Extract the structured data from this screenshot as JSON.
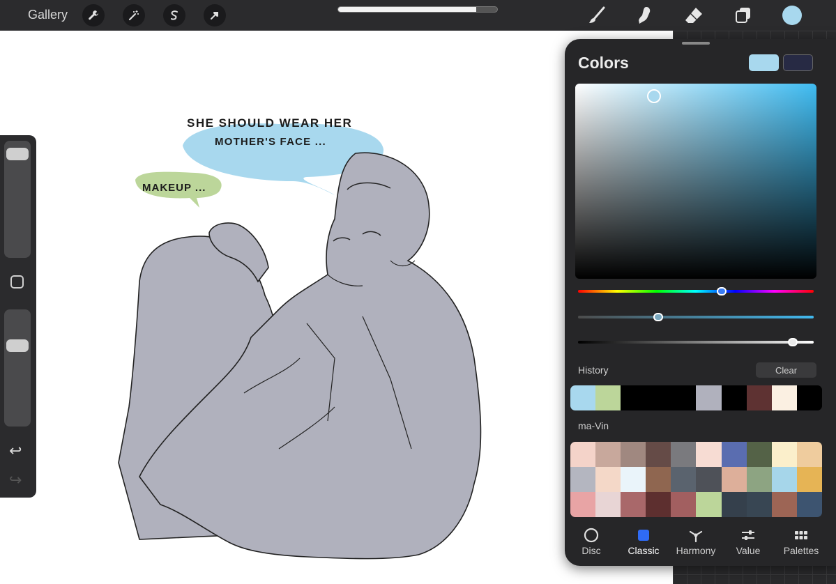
{
  "topbar": {
    "gallery_label": "Gallery",
    "left_tools": [
      {
        "icon": "wrench-icon",
        "name": "actions-button"
      },
      {
        "icon": "magic-wand-icon",
        "name": "adjustments-button"
      },
      {
        "icon": "selection-icon",
        "name": "selection-button"
      },
      {
        "icon": "arrow-cursor-icon",
        "name": "transform-button"
      }
    ],
    "progress": 0.87,
    "right_tools": [
      {
        "icon": "brush-icon",
        "name": "brush-button"
      },
      {
        "icon": "smudge-icon",
        "name": "smudge-button"
      },
      {
        "icon": "eraser-icon",
        "name": "eraser-button"
      },
      {
        "icon": "layers-icon",
        "name": "layers-button"
      }
    ],
    "current_color": "#a8d8ee"
  },
  "sidebar": {
    "brush_size_level": 0.05,
    "opacity_level": 0.28,
    "modifier_icon": "square-icon",
    "undo_icon": "undo-icon",
    "redo_icon": "redo-icon"
  },
  "colors_panel": {
    "title": "Colors",
    "primary_color": "#a8d8ee",
    "secondary_color": "#272a44",
    "hue_level": 0.61,
    "saturation_level": 0.34,
    "brightness_level": 0.91,
    "history_label": "History",
    "clear_label": "Clear",
    "history_colors": [
      "#a8d8ee",
      "#bcd69a",
      "#000000",
      "#000000",
      "#000000",
      "#b0b1bd",
      "#000000",
      "#5e3232",
      "#fbf0e2",
      "#000000"
    ],
    "palette_name": "ma-Vin",
    "palette_colors": [
      "#f4d3c9",
      "#c8a89c",
      "#a08880",
      "#654b47",
      "#7a7a7e",
      "#f7dcd3",
      "#5a6db0",
      "#546247",
      "#fbefcb",
      "#efcc9e",
      "#b4b6c0",
      "#f4d8c8",
      "#eaf4fa",
      "#8f6650",
      "#5a636e",
      "#4e5158",
      "#ddaf9a",
      "#8da482",
      "#a6d6ea",
      "#e6b455",
      "#e8a4a5",
      "#e8d5d5",
      "#a9686a",
      "#5d2f2f",
      "#a25f60",
      "#bcd69a",
      "#35404c",
      "#384653",
      "#9d6555",
      "#3d5470"
    ],
    "tabs": [
      {
        "label": "Disc",
        "icon": "circle-icon"
      },
      {
        "label": "Classic",
        "icon": "square-icon"
      },
      {
        "label": "Harmony",
        "icon": "harmony-icon"
      },
      {
        "label": "Value",
        "icon": "sliders-icon"
      },
      {
        "label": "Palettes",
        "icon": "grid-icon"
      }
    ],
    "active_tab": "Classic"
  },
  "artwork": {
    "bubble_1": [
      "SHE SHOULD WEAR HER",
      "MOTHER'S FACE ..."
    ],
    "bubble_2": "MAKEUP ...",
    "bubble_1_color": "#a8d8ee",
    "bubble_2_color": "#bcd69a",
    "figure_fill": "#b0b1bd"
  }
}
